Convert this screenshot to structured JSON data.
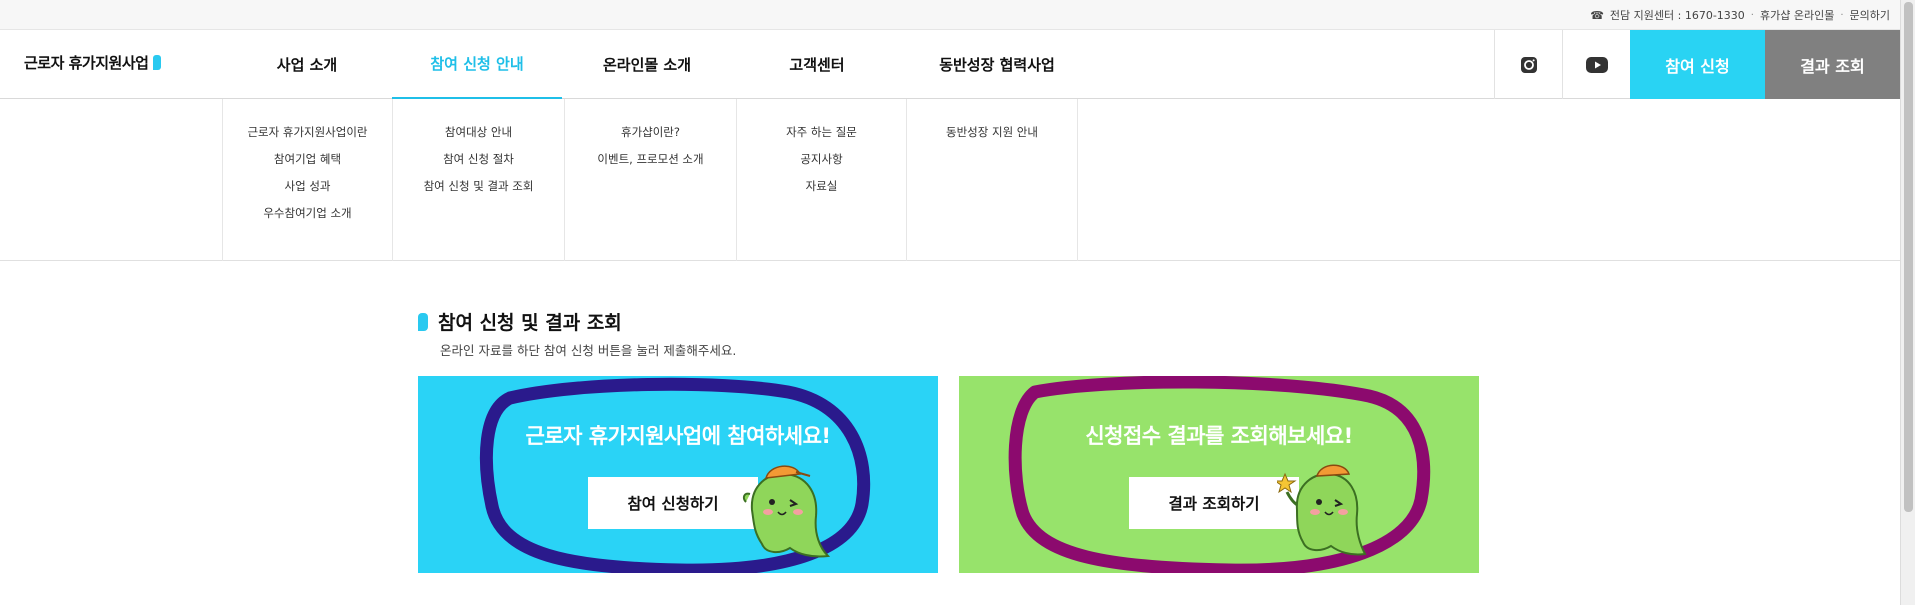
{
  "utility": {
    "support_center": "전담 지원센터 : 1670-1330",
    "online_mall": "휴가샵 온라인몰",
    "inquiry": "문의하기"
  },
  "header": {
    "logo": "근로자 휴가지원사업",
    "nav": [
      "사업 소개",
      "참여 신청 안내",
      "온라인몰 소개",
      "고객센터",
      "동반성장 협력사업"
    ],
    "active_index": 1,
    "apply_button": "참여 신청",
    "result_button": "결과 조회",
    "social": [
      "instagram-icon",
      "youtube-icon"
    ]
  },
  "mega_menu": [
    {
      "items": [
        "근로자 휴가지원사업이란",
        "참여기업 혜택",
        "사업 성과",
        "우수참여기업 소개"
      ]
    },
    {
      "items": [
        "참여대상 안내",
        "참여 신청 절차",
        "참여 신청 및 결과 조회"
      ]
    },
    {
      "items": [
        "휴가샵이란?",
        "이벤트, 프로모션 소개"
      ]
    },
    {
      "items": [
        "자주 하는 질문",
        "공지사항",
        "자료실"
      ]
    },
    {
      "items": [
        "동반성장 지원 안내"
      ]
    }
  ],
  "content": {
    "title": "참여 신청 및 결과 조회",
    "subtitle": "온라인 자료를 하단 참여 신청 버튼을 눌러 제출해주세요.",
    "cards": [
      {
        "headline": "근로자 휴가지원사업에 참여하세요!",
        "button": "참여 신청하기"
      },
      {
        "headline": "신청접수 결과를 조회해보세요!",
        "button": "결과 조회하기"
      }
    ]
  },
  "colors": {
    "accent": "#29d3f3",
    "result_gray": "#808080",
    "card_blue": "#2ad3f6",
    "card_green": "#97e36b",
    "ring_blue": "#2a1a8c",
    "ring_magenta": "#8c0a6e"
  }
}
